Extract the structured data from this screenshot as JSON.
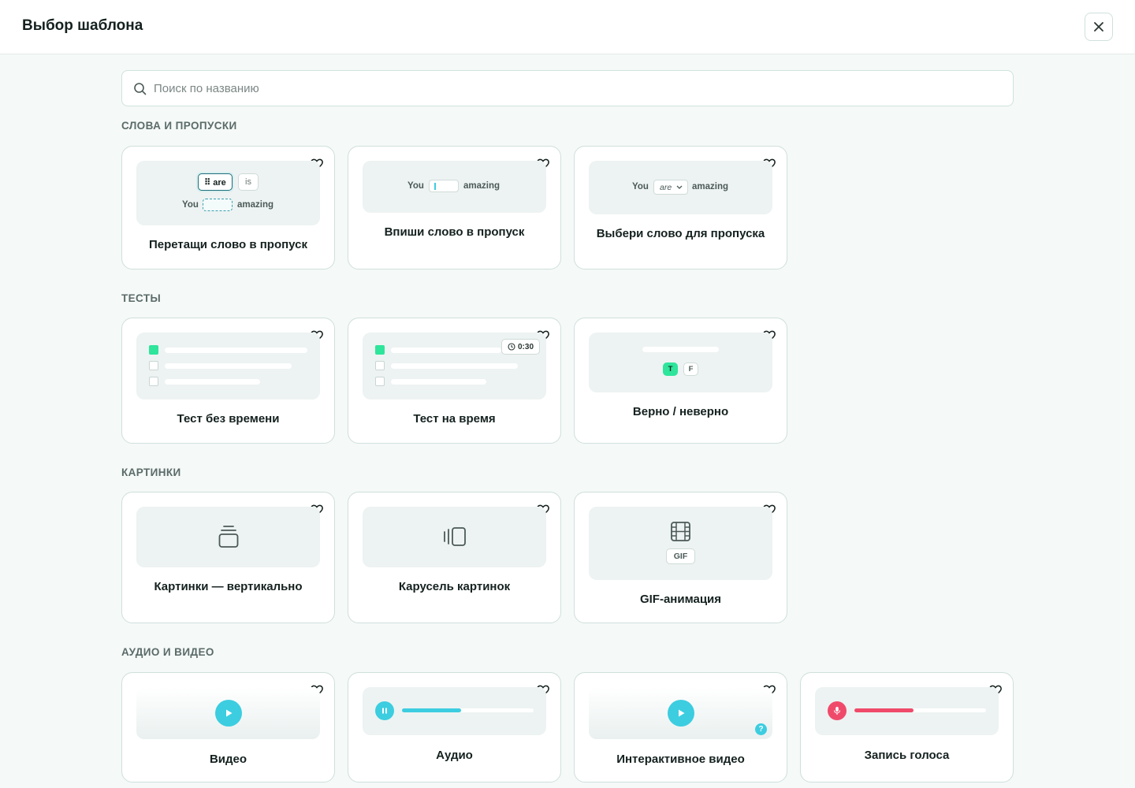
{
  "header": {
    "title": "Выбор шаблона"
  },
  "search": {
    "placeholder": "Поиск по названию",
    "value": ""
  },
  "sections": [
    {
      "title": "СЛОВА И ПРОПУСКИ",
      "cards": [
        "Перетащи слово в пропуск",
        "Впиши слово в пропуск",
        "Выбери слово для пропуска"
      ]
    },
    {
      "title": "ТЕСТЫ",
      "cards": [
        "Тест без времени",
        "Тест на время",
        "Верно / неверно"
      ]
    },
    {
      "title": "КАРТИНКИ",
      "cards": [
        "Картинки — вертикально",
        "Карусель картинок",
        "GIF-анимация"
      ]
    },
    {
      "title": "АУДИО И ВИДЕО",
      "cards": [
        "Видео",
        "Аудио",
        "Интерактивное видео",
        "Запись голоса"
      ]
    }
  ],
  "preview": {
    "word_you": "You",
    "word_amazing": "amazing",
    "chip_are": "⠿ are",
    "chip_is": "is",
    "select_are": "are",
    "timer": "0:30",
    "true_label": "T",
    "false_label": "F",
    "gif_badge": "GIF",
    "question_mark": "?"
  },
  "audio_progress": 0.45,
  "voice_progress": 0.45,
  "colors": {
    "accent_green": "#2ee59b",
    "accent_cyan": "#3ccde0",
    "record_red": "#f04a6a",
    "border": "#cfe0dc"
  },
  "icons": [
    "close-icon",
    "search-icon",
    "heart-icon",
    "clock-icon",
    "stack-icon",
    "carousel-icon",
    "film-icon",
    "play-icon",
    "pause-icon",
    "mic-icon",
    "chevron-down-icon"
  ]
}
